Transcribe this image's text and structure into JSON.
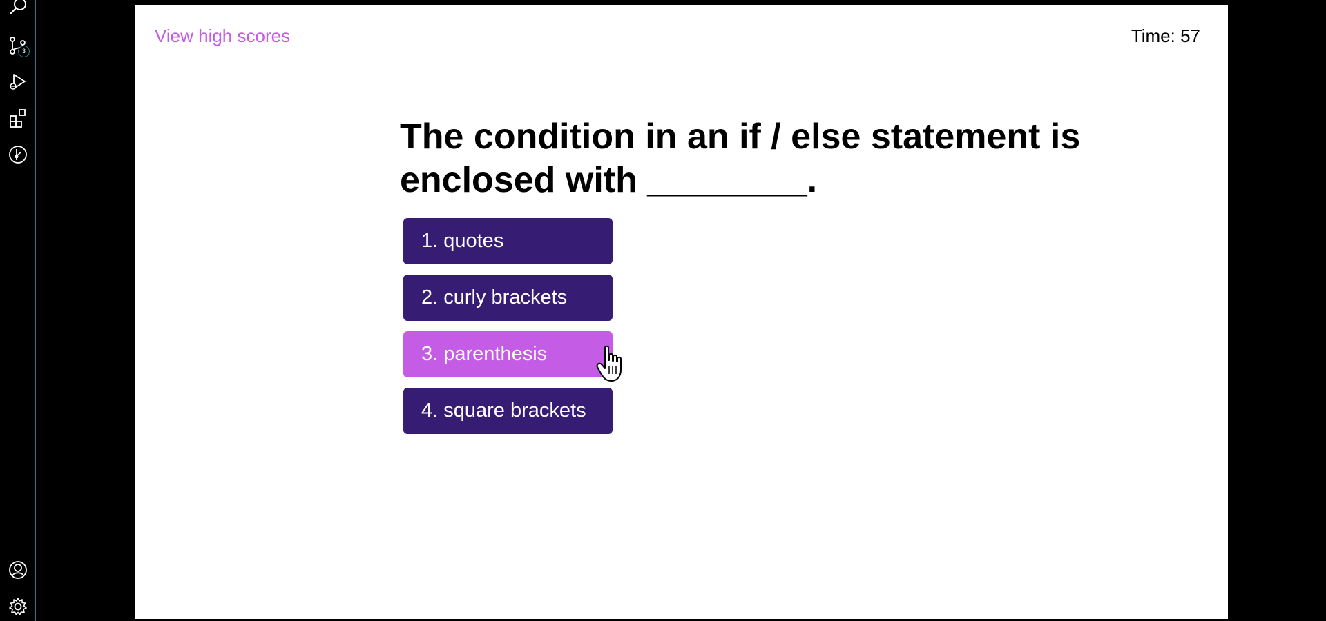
{
  "activity_bar": {
    "source_control_badge": "3",
    "icons": [
      "search-icon",
      "source-control-icon",
      "run-debug-icon",
      "extensions-icon",
      "git-graph-icon",
      "account-icon",
      "settings-gear-icon"
    ]
  },
  "header": {
    "high_scores_link": "View high scores",
    "timer_label": "Time: 57"
  },
  "quiz": {
    "question": "The condition in an if / else statement is enclosed with ________.",
    "answers": [
      "1. quotes",
      "2. curly brackets",
      "3. parenthesis",
      "4. square brackets"
    ],
    "hovered_answer_index": 2
  },
  "colors": {
    "accent": "#c45ce6",
    "button": "#371c73",
    "activity_border": "#2f7a8a"
  }
}
